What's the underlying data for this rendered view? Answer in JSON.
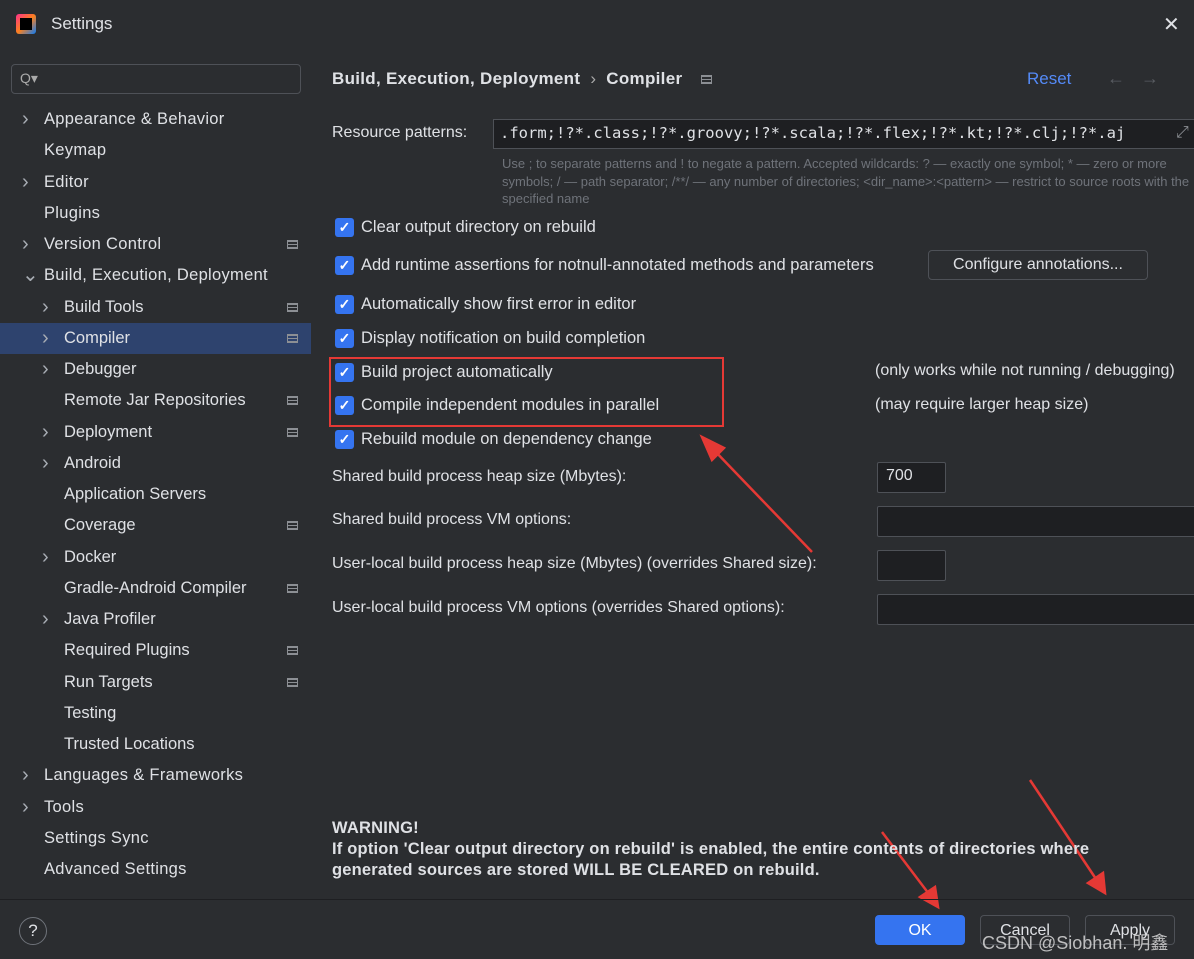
{
  "window": {
    "title": "Settings",
    "close_icon": "close-icon"
  },
  "search": {
    "placeholder": "Q▾"
  },
  "sidebar": {
    "items": [
      {
        "label": "Appearance & Behavior",
        "level": 0,
        "expandable": true,
        "gear": false
      },
      {
        "label": "Keymap",
        "level": 0,
        "expandable": false,
        "gear": false
      },
      {
        "label": "Editor",
        "level": 0,
        "expandable": true,
        "gear": false
      },
      {
        "label": "Plugins",
        "level": 0,
        "expandable": false,
        "gear": false
      },
      {
        "label": "Version Control",
        "level": 0,
        "expandable": true,
        "gear": true
      },
      {
        "label": "Build, Execution, Deployment",
        "level": 0,
        "expandable": true,
        "expanded": true,
        "gear": false
      },
      {
        "label": "Build Tools",
        "level": 1,
        "expandable": true,
        "gear": true
      },
      {
        "label": "Compiler",
        "level": 1,
        "expandable": true,
        "gear": true,
        "selected": true
      },
      {
        "label": "Debugger",
        "level": 1,
        "expandable": true,
        "gear": false
      },
      {
        "label": "Remote Jar Repositories",
        "level": 1,
        "expandable": false,
        "gear": true
      },
      {
        "label": "Deployment",
        "level": 1,
        "expandable": true,
        "gear": true
      },
      {
        "label": "Android",
        "level": 1,
        "expandable": true,
        "gear": false
      },
      {
        "label": "Application Servers",
        "level": 1,
        "expandable": false,
        "gear": false
      },
      {
        "label": "Coverage",
        "level": 1,
        "expandable": false,
        "gear": true
      },
      {
        "label": "Docker",
        "level": 1,
        "expandable": true,
        "gear": false
      },
      {
        "label": "Gradle-Android Compiler",
        "level": 1,
        "expandable": false,
        "gear": true
      },
      {
        "label": "Java Profiler",
        "level": 1,
        "expandable": true,
        "gear": false
      },
      {
        "label": "Required Plugins",
        "level": 1,
        "expandable": false,
        "gear": true
      },
      {
        "label": "Run Targets",
        "level": 1,
        "expandable": false,
        "gear": true
      },
      {
        "label": "Testing",
        "level": 1,
        "expandable": false,
        "gear": false
      },
      {
        "label": "Trusted Locations",
        "level": 1,
        "expandable": false,
        "gear": false
      },
      {
        "label": "Languages & Frameworks",
        "level": 0,
        "expandable": true,
        "gear": false
      },
      {
        "label": "Tools",
        "level": 0,
        "expandable": true,
        "gear": false
      },
      {
        "label": "Settings Sync",
        "level": 0,
        "expandable": false,
        "gear": false
      },
      {
        "label": "Advanced Settings",
        "level": 0,
        "expandable": false,
        "gear": false
      }
    ]
  },
  "header": {
    "crumb1": "Build, Execution, Deployment",
    "sep": "›",
    "crumb2": "Compiler",
    "reset": "Reset",
    "back": "←",
    "forward": "→"
  },
  "main": {
    "resource_label": "Resource patterns:",
    "resource_value": ".form;!?*.class;!?*.groovy;!?*.scala;!?*.flex;!?*.kt;!?*.clj;!?*.aj",
    "hint": "Use ; to separate patterns and ! to negate a pattern. Accepted wildcards: ? — exactly one symbol; * — zero or more symbols; / — path separator; /**/ — any number of directories; <dir_name>:<pattern> — restrict to source roots with the specified name",
    "checkboxes": [
      {
        "label": "Clear output directory on rebuild",
        "checked": true
      },
      {
        "label": "Add runtime assertions for notnull-annotated methods and parameters",
        "checked": true
      },
      {
        "label": "Automatically show first error in editor",
        "checked": true
      },
      {
        "label": "Display notification on build completion",
        "checked": true
      },
      {
        "label": "Build project automatically",
        "checked": true
      },
      {
        "label": "Compile independent modules in parallel",
        "checked": true
      },
      {
        "label": "Rebuild module on dependency change",
        "checked": true
      }
    ],
    "configure_annotations": "Configure annotations...",
    "note_auto": "(only works while not running / debugging)",
    "note_parallel": "(may require larger heap size)",
    "heap_label": "Shared build process heap size (Mbytes):",
    "heap_value": "700",
    "vm_label": "Shared build process VM options:",
    "local_heap_label": "User-local build process heap size (Mbytes) (overrides Shared size):",
    "local_vm_label": "User-local build process VM options (overrides Shared options):",
    "warning_title": "WARNING!",
    "warning_text": "If option 'Clear output directory on rebuild' is enabled, the entire contents of directories where generated sources are stored WILL BE CLEARED on rebuild."
  },
  "footer": {
    "help": "?",
    "ok": "OK",
    "cancel": "Cancel",
    "apply": "Apply"
  },
  "watermark": "CSDN @Siobhan. 明鑫",
  "colors": {
    "accent": "#3574f0",
    "link": "#548af7",
    "selection": "#2e436e",
    "annotation": "#e53935"
  }
}
